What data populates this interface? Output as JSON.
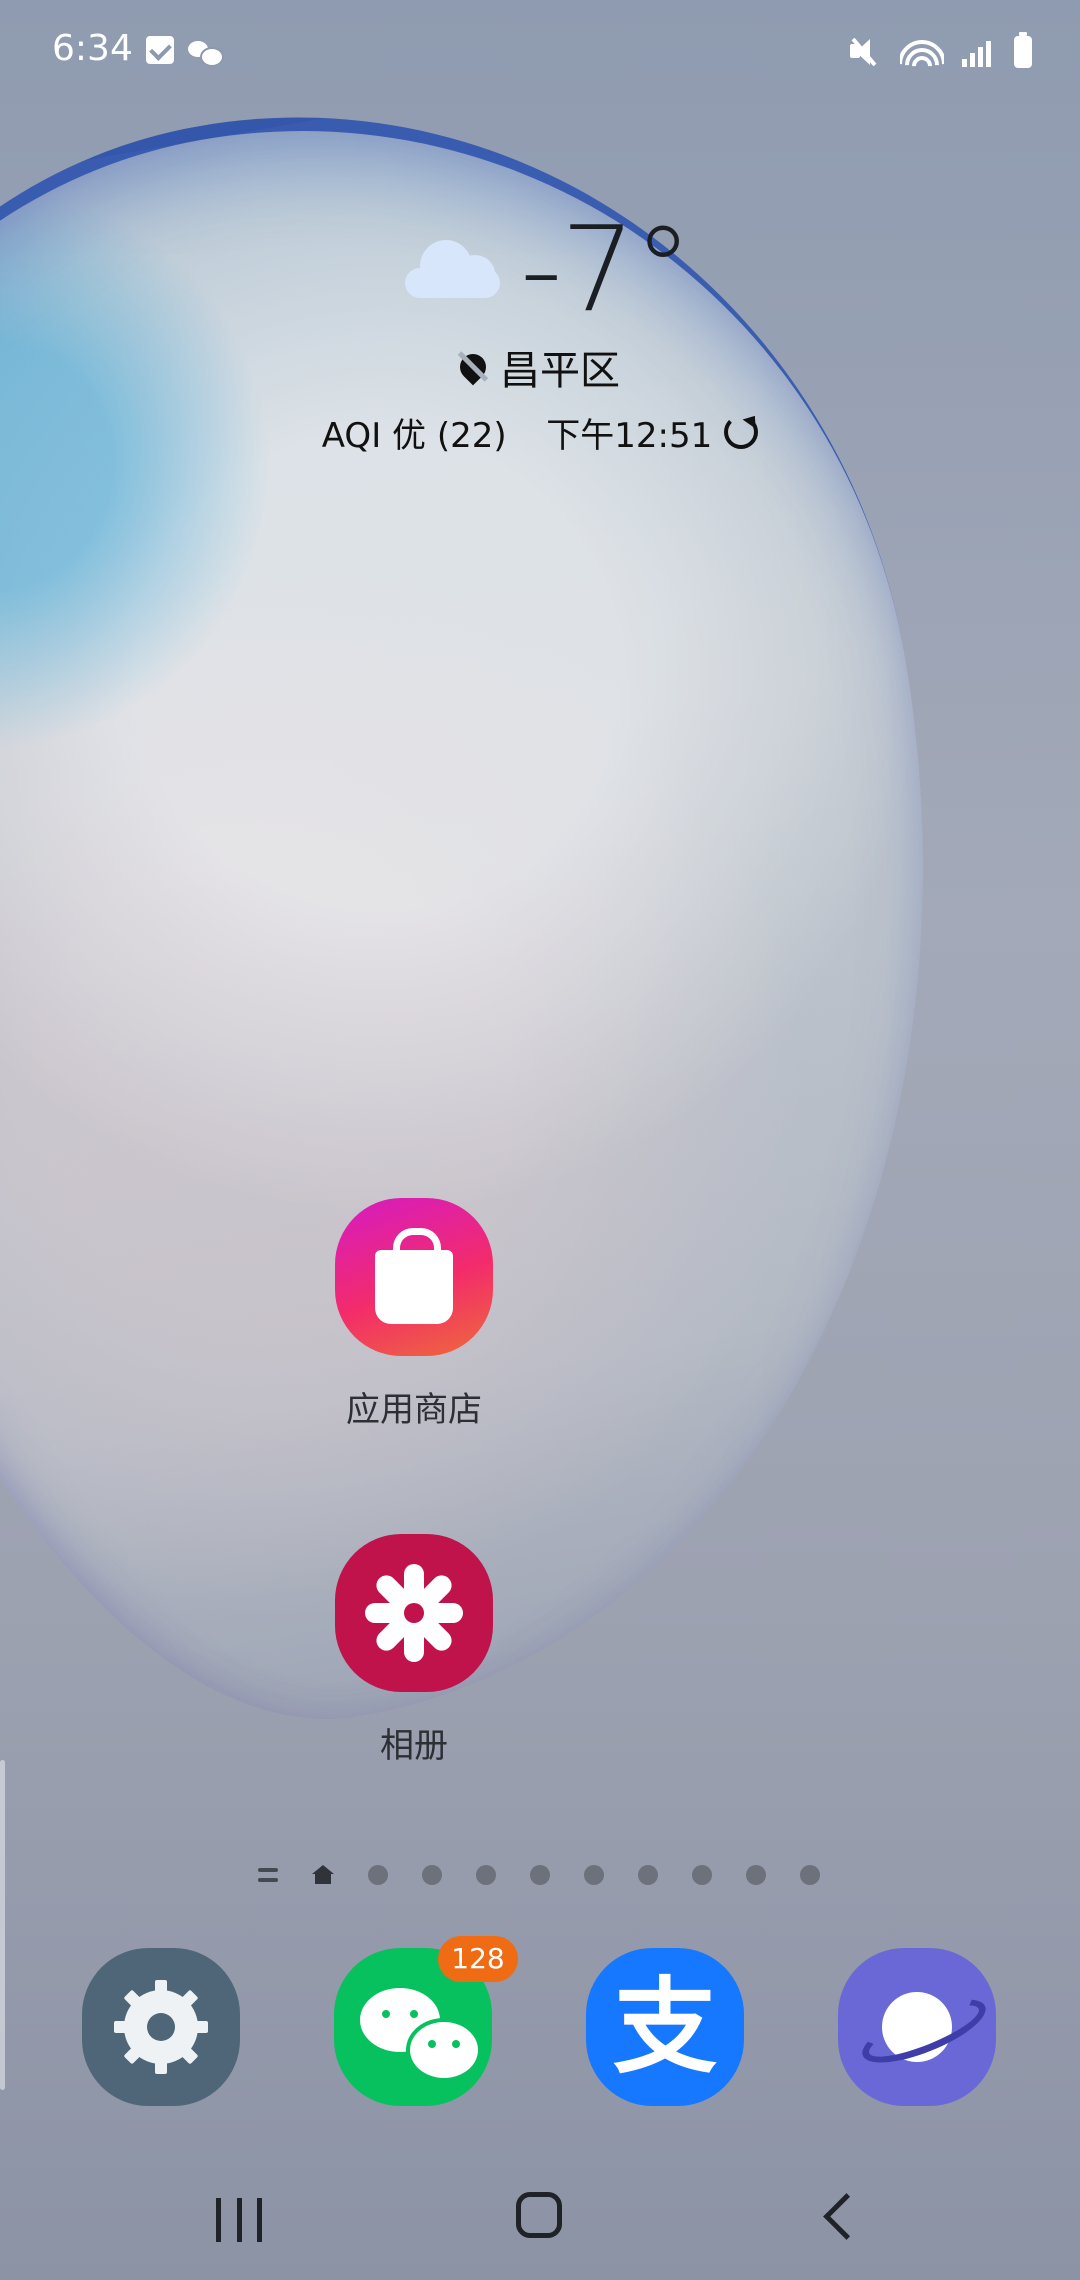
{
  "status_bar": {
    "time": "6:34",
    "icons": [
      "check-notification-icon",
      "wechat-notification-icon",
      "mute-icon",
      "wifi-icon",
      "signal-icon",
      "battery-icon"
    ]
  },
  "weather": {
    "temperature": "-7°",
    "location": "昌平区",
    "aqi": "AQI 优 (22)",
    "updated": "下午12:51"
  },
  "home_apps": [
    {
      "label": "应用商店",
      "icon": "shopping-bag-icon"
    },
    {
      "label": "相册",
      "icon": "flower-icon"
    }
  ],
  "page_indicator": {
    "pages": 10,
    "current": "home"
  },
  "dock": [
    {
      "name": "settings",
      "icon": "gear-icon"
    },
    {
      "name": "wechat",
      "icon": "wechat-icon",
      "badge": "128"
    },
    {
      "name": "alipay",
      "icon": "alipay-icon",
      "glyph": "支"
    },
    {
      "name": "browser",
      "icon": "planet-icon"
    }
  ],
  "colors": {
    "badge": "#ef6b14",
    "wechat_green": "#07c15f",
    "alipay_blue": "#1677ff",
    "gallery_red": "#c0124b"
  }
}
